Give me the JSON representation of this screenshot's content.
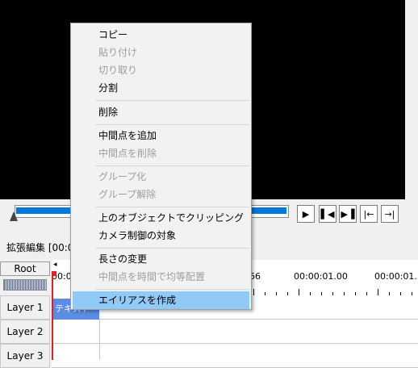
{
  "menu": {
    "items": [
      {
        "label": "コピー",
        "enabled": true
      },
      {
        "label": "貼り付け",
        "enabled": false
      },
      {
        "label": "切り取り",
        "enabled": false
      },
      {
        "label": "分割",
        "enabled": true
      },
      {
        "label": "削除",
        "enabled": true
      },
      {
        "label": "中間点を追加",
        "enabled": true
      },
      {
        "label": "中間点を削除",
        "enabled": false
      },
      {
        "label": "グループ化",
        "enabled": false
      },
      {
        "label": "グループ解除",
        "enabled": false
      },
      {
        "label": "上のオブジェクトでクリッピング",
        "enabled": true
      },
      {
        "label": "カメラ制御の対象",
        "enabled": true
      },
      {
        "label": "長さの変更",
        "enabled": true
      },
      {
        "label": "中間点を時間で均等配置",
        "enabled": false
      },
      {
        "label": "エイリアスを作成",
        "enabled": true,
        "highlighted": true
      }
    ]
  },
  "player": {
    "play_icon": "play-icon",
    "prev_frame_icon": "prev-frame-icon",
    "next_frame_icon": "next-frame-icon",
    "start_icon": "jump-start-icon",
    "end_icon": "jump-end-icon",
    "accent": "#0078d7"
  },
  "timeline": {
    "title": "拡張編集 [00:00",
    "root_label": "Root",
    "ticks": [
      "00:0",
      "66",
      "00:00:01.00",
      "00:00:01.33"
    ],
    "layers": [
      "Layer 1",
      "Layer 2",
      "Layer 3"
    ],
    "clip_label": "テキスト[標"
  }
}
